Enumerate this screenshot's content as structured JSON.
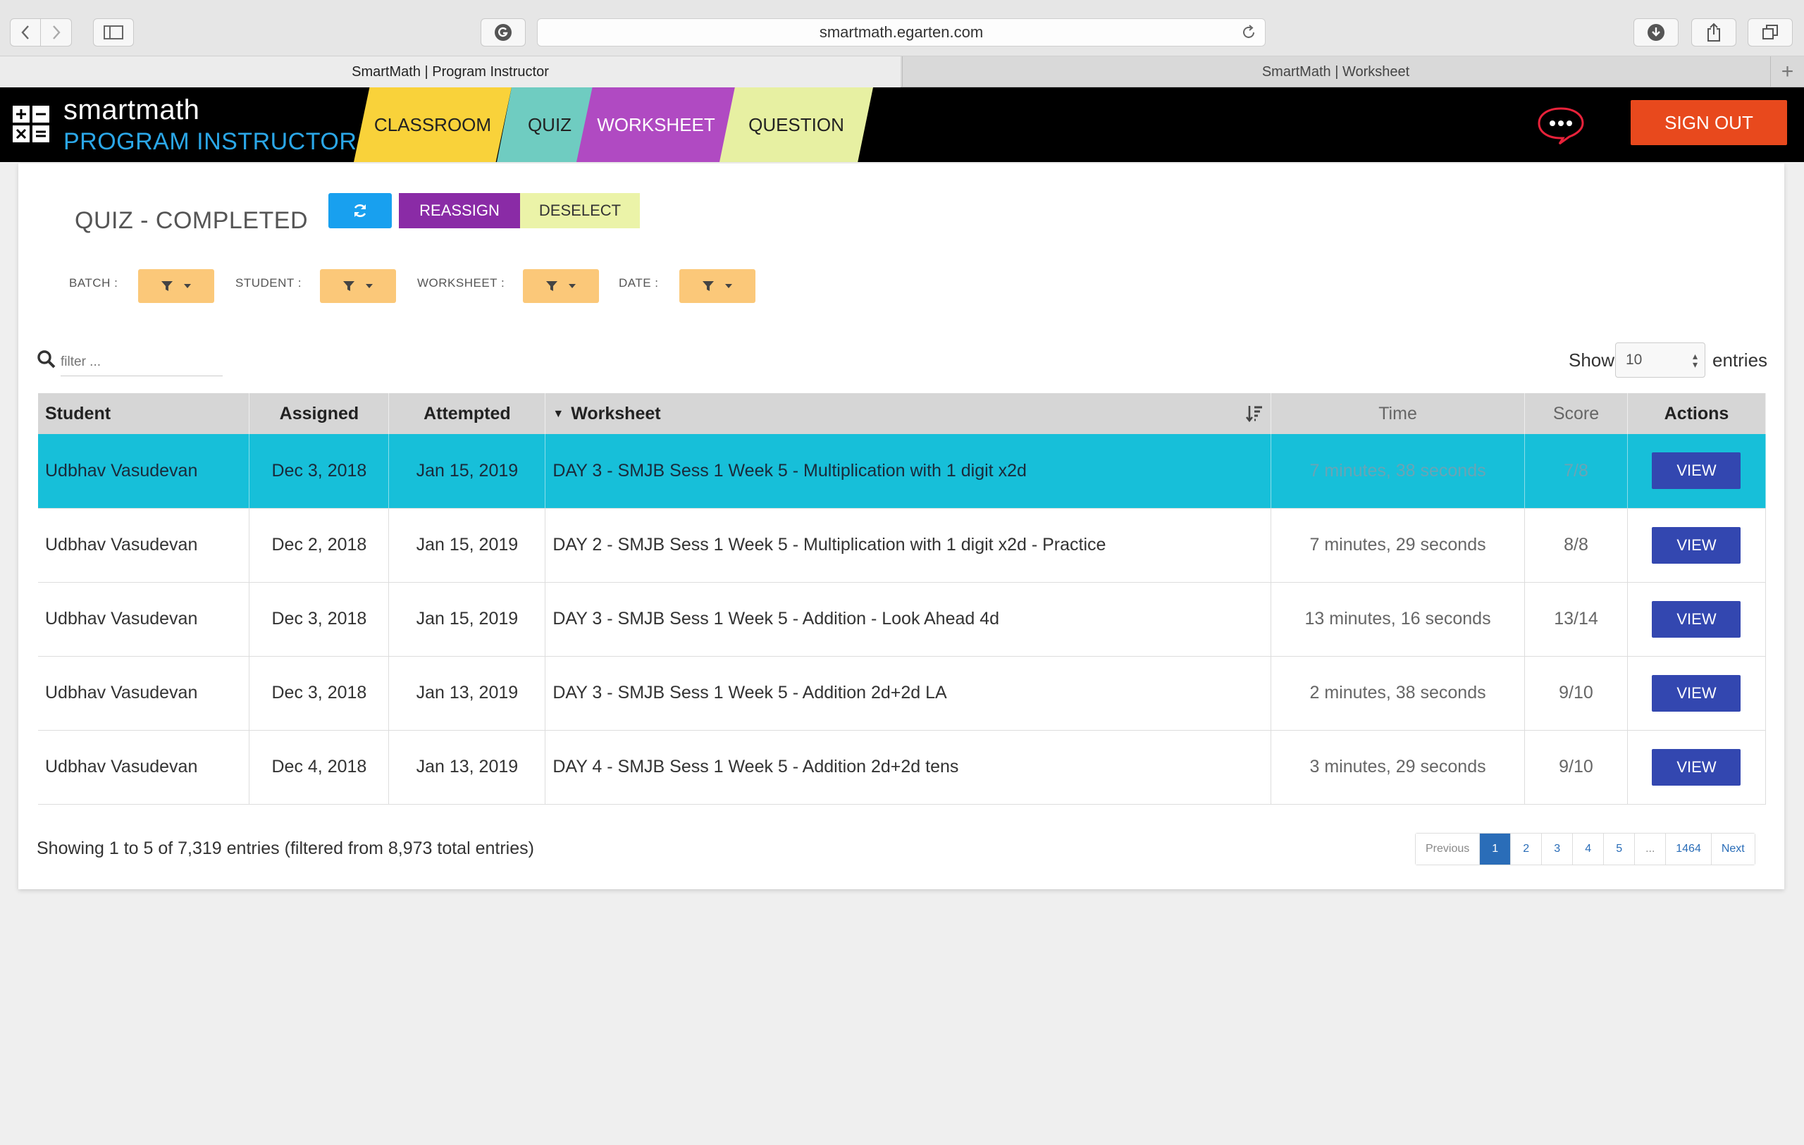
{
  "browser": {
    "url": "smartmath.egarten.com",
    "tabs": [
      {
        "title": "SmartMath | Program Instructor",
        "active": true
      },
      {
        "title": "SmartMath | Worksheet",
        "active": false
      }
    ],
    "new_tab_label": "+"
  },
  "header": {
    "brand_name": "smartmath",
    "brand_role": "PROGRAM INSTRUCTOR",
    "nav": {
      "classroom": "CLASSROOM",
      "quiz": "QUIZ",
      "worksheet": "WORKSHEET",
      "question": "QUESTION"
    },
    "sign_out": "SIGN OUT"
  },
  "page": {
    "title": "QUIZ - COMPLETED",
    "actions": {
      "reassign": "REASSIGN",
      "deselect": "DESELECT"
    },
    "filters": {
      "batch": "BATCH :",
      "student": "STUDENT :",
      "worksheet": "WORKSHEET :",
      "date": "DATE :"
    },
    "search": {
      "placeholder": "filter ..."
    },
    "length": {
      "show": "Show",
      "value": "10",
      "entries": "entries"
    }
  },
  "table": {
    "columns": {
      "student": "Student",
      "assigned": "Assigned",
      "attempted": "Attempted",
      "worksheet": "Worksheet",
      "time": "Time",
      "score": "Score",
      "actions": "Actions"
    },
    "view_label": "VIEW",
    "rows": [
      {
        "student": "Udbhav Vasudevan",
        "assigned": "Dec 3, 2018",
        "attempted": "Jan 15, 2019",
        "worksheet": "DAY 3 - SMJB Sess 1 Week 5 - Multiplication with 1 digit x2d",
        "time": "7 minutes, 38 seconds",
        "score": "7/8",
        "selected": true
      },
      {
        "student": "Udbhav Vasudevan",
        "assigned": "Dec 2, 2018",
        "attempted": "Jan 15, 2019",
        "worksheet": "DAY 2 - SMJB Sess 1 Week 5 - Multiplication with 1 digit x2d - Practice",
        "time": "7 minutes, 29 seconds",
        "score": "8/8",
        "selected": false
      },
      {
        "student": "Udbhav Vasudevan",
        "assigned": "Dec 3, 2018",
        "attempted": "Jan 15, 2019",
        "worksheet": "DAY 3 - SMJB Sess 1 Week 5 - Addition - Look Ahead 4d",
        "time": "13 minutes, 16 seconds",
        "score": "13/14",
        "selected": false
      },
      {
        "student": "Udbhav Vasudevan",
        "assigned": "Dec 3, 2018",
        "attempted": "Jan 13, 2019",
        "worksheet": "DAY 3 - SMJB Sess 1 Week 5 - Addition 2d+2d LA",
        "time": "2 minutes, 38 seconds",
        "score": "9/10",
        "selected": false
      },
      {
        "student": "Udbhav Vasudevan",
        "assigned": "Dec 4, 2018",
        "attempted": "Jan 13, 2019",
        "worksheet": "DAY 4 - SMJB Sess 1 Week 5 - Addition 2d+2d tens",
        "time": "3 minutes, 29 seconds",
        "score": "9/10",
        "selected": false
      }
    ]
  },
  "footer": {
    "summary": "Showing 1 to 5 of 7,319 entries (filtered from 8,973 total entries)",
    "pagination": {
      "previous": "Previous",
      "pages": [
        "1",
        "2",
        "3",
        "4",
        "5",
        "...",
        "1464"
      ],
      "next": "Next",
      "current": "1"
    }
  },
  "colors": {
    "classroom_tab": "#f9d23a",
    "quiz_tab": "#6fccc1",
    "worksheet_tab": "#b04ac2",
    "question_tab": "#e7f0a2",
    "sign_out": "#e8491d",
    "selected_row": "#17bfd9",
    "view_button": "#3347b0",
    "filter_button": "#fbc879"
  }
}
